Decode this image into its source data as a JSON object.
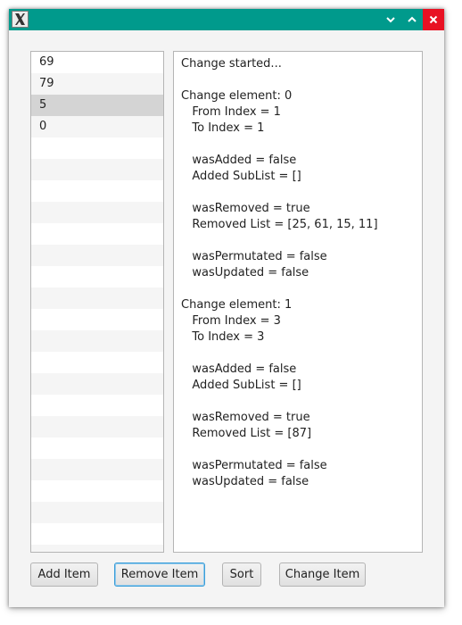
{
  "window": {
    "title": "",
    "icon": "x11-app-icon",
    "titlebar_color": "#009a8c",
    "close_color": "#e81123"
  },
  "list": {
    "items": [
      "69",
      "79",
      "5",
      "0"
    ],
    "selected_index": 2
  },
  "log": {
    "text": "Change started...\n\nChange element: 0\n   From Index = 1\n   To Index = 1\n\n   wasAdded = false\n   Added SubList = []\n\n   wasRemoved = true\n   Removed List = [25, 61, 15, 11]\n\n   wasPermutated = false\n   wasUpdated = false\n\nChange element: 1\n   From Index = 3\n   To Index = 3\n\n   wasAdded = false\n   Added SubList = []\n\n   wasRemoved = true\n   Removed List = [87]\n\n   wasPermutated = false\n   wasUpdated = false"
  },
  "buttons": {
    "add": "Add Item",
    "remove": "Remove Item",
    "sort": "Sort",
    "change": "Change Item"
  }
}
